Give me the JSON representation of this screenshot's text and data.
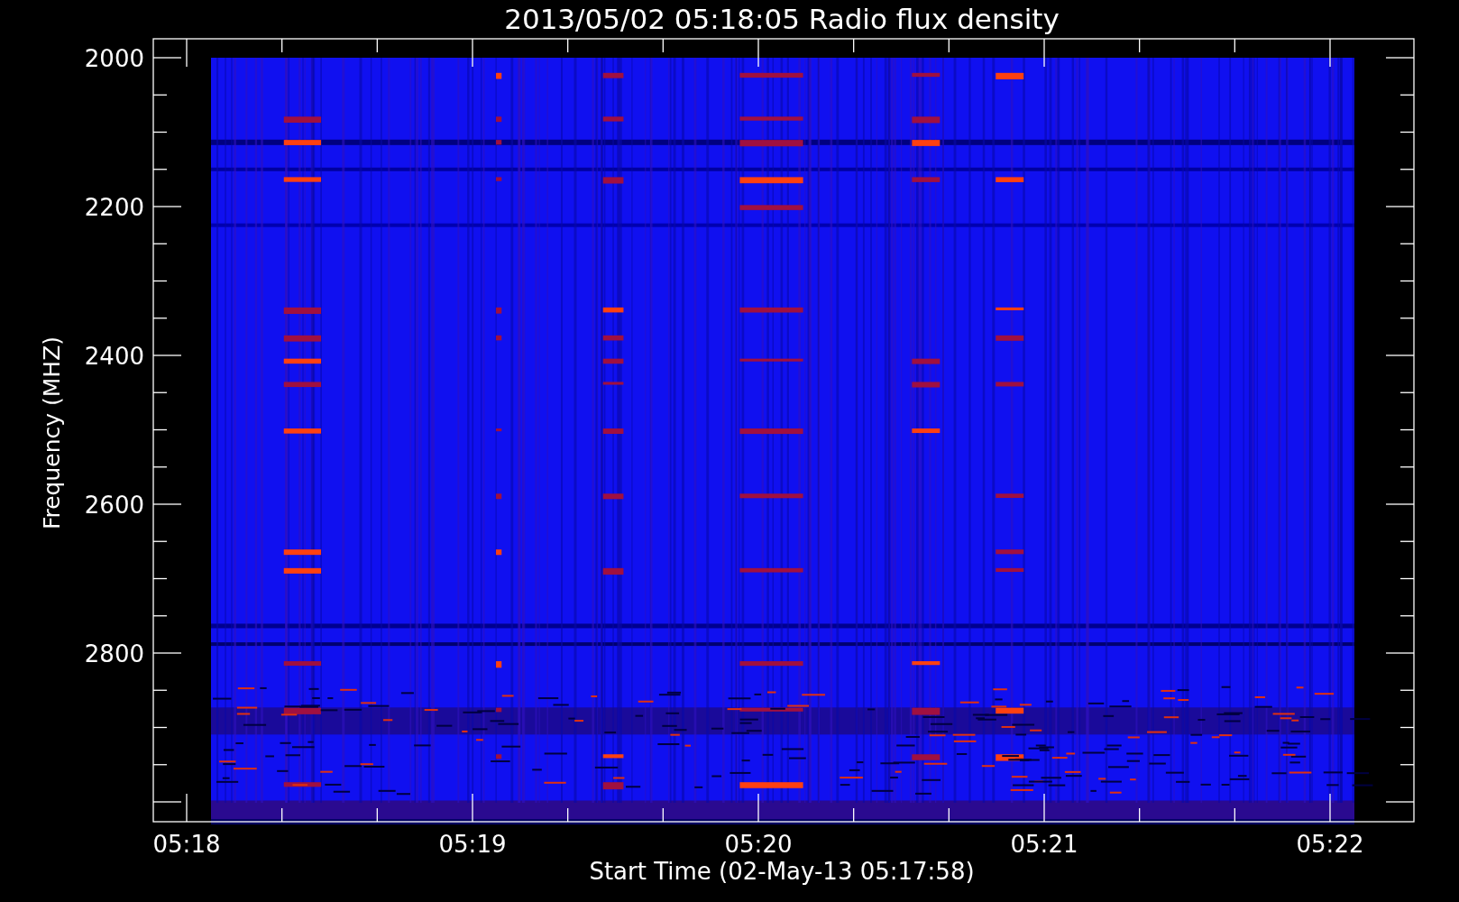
{
  "title": "2013/05/02 05:18:05 Radio flux density",
  "y_axis": {
    "label": "Frequency (MHZ)",
    "ticks": [
      "2000",
      "2200",
      "2400",
      "2600",
      "2800"
    ]
  },
  "x_axis": {
    "label": "Start Time (02-May-13 05:17:58)",
    "ticks": [
      "05:18",
      "05:19",
      "05:20",
      "05:21",
      "05:22"
    ]
  }
}
